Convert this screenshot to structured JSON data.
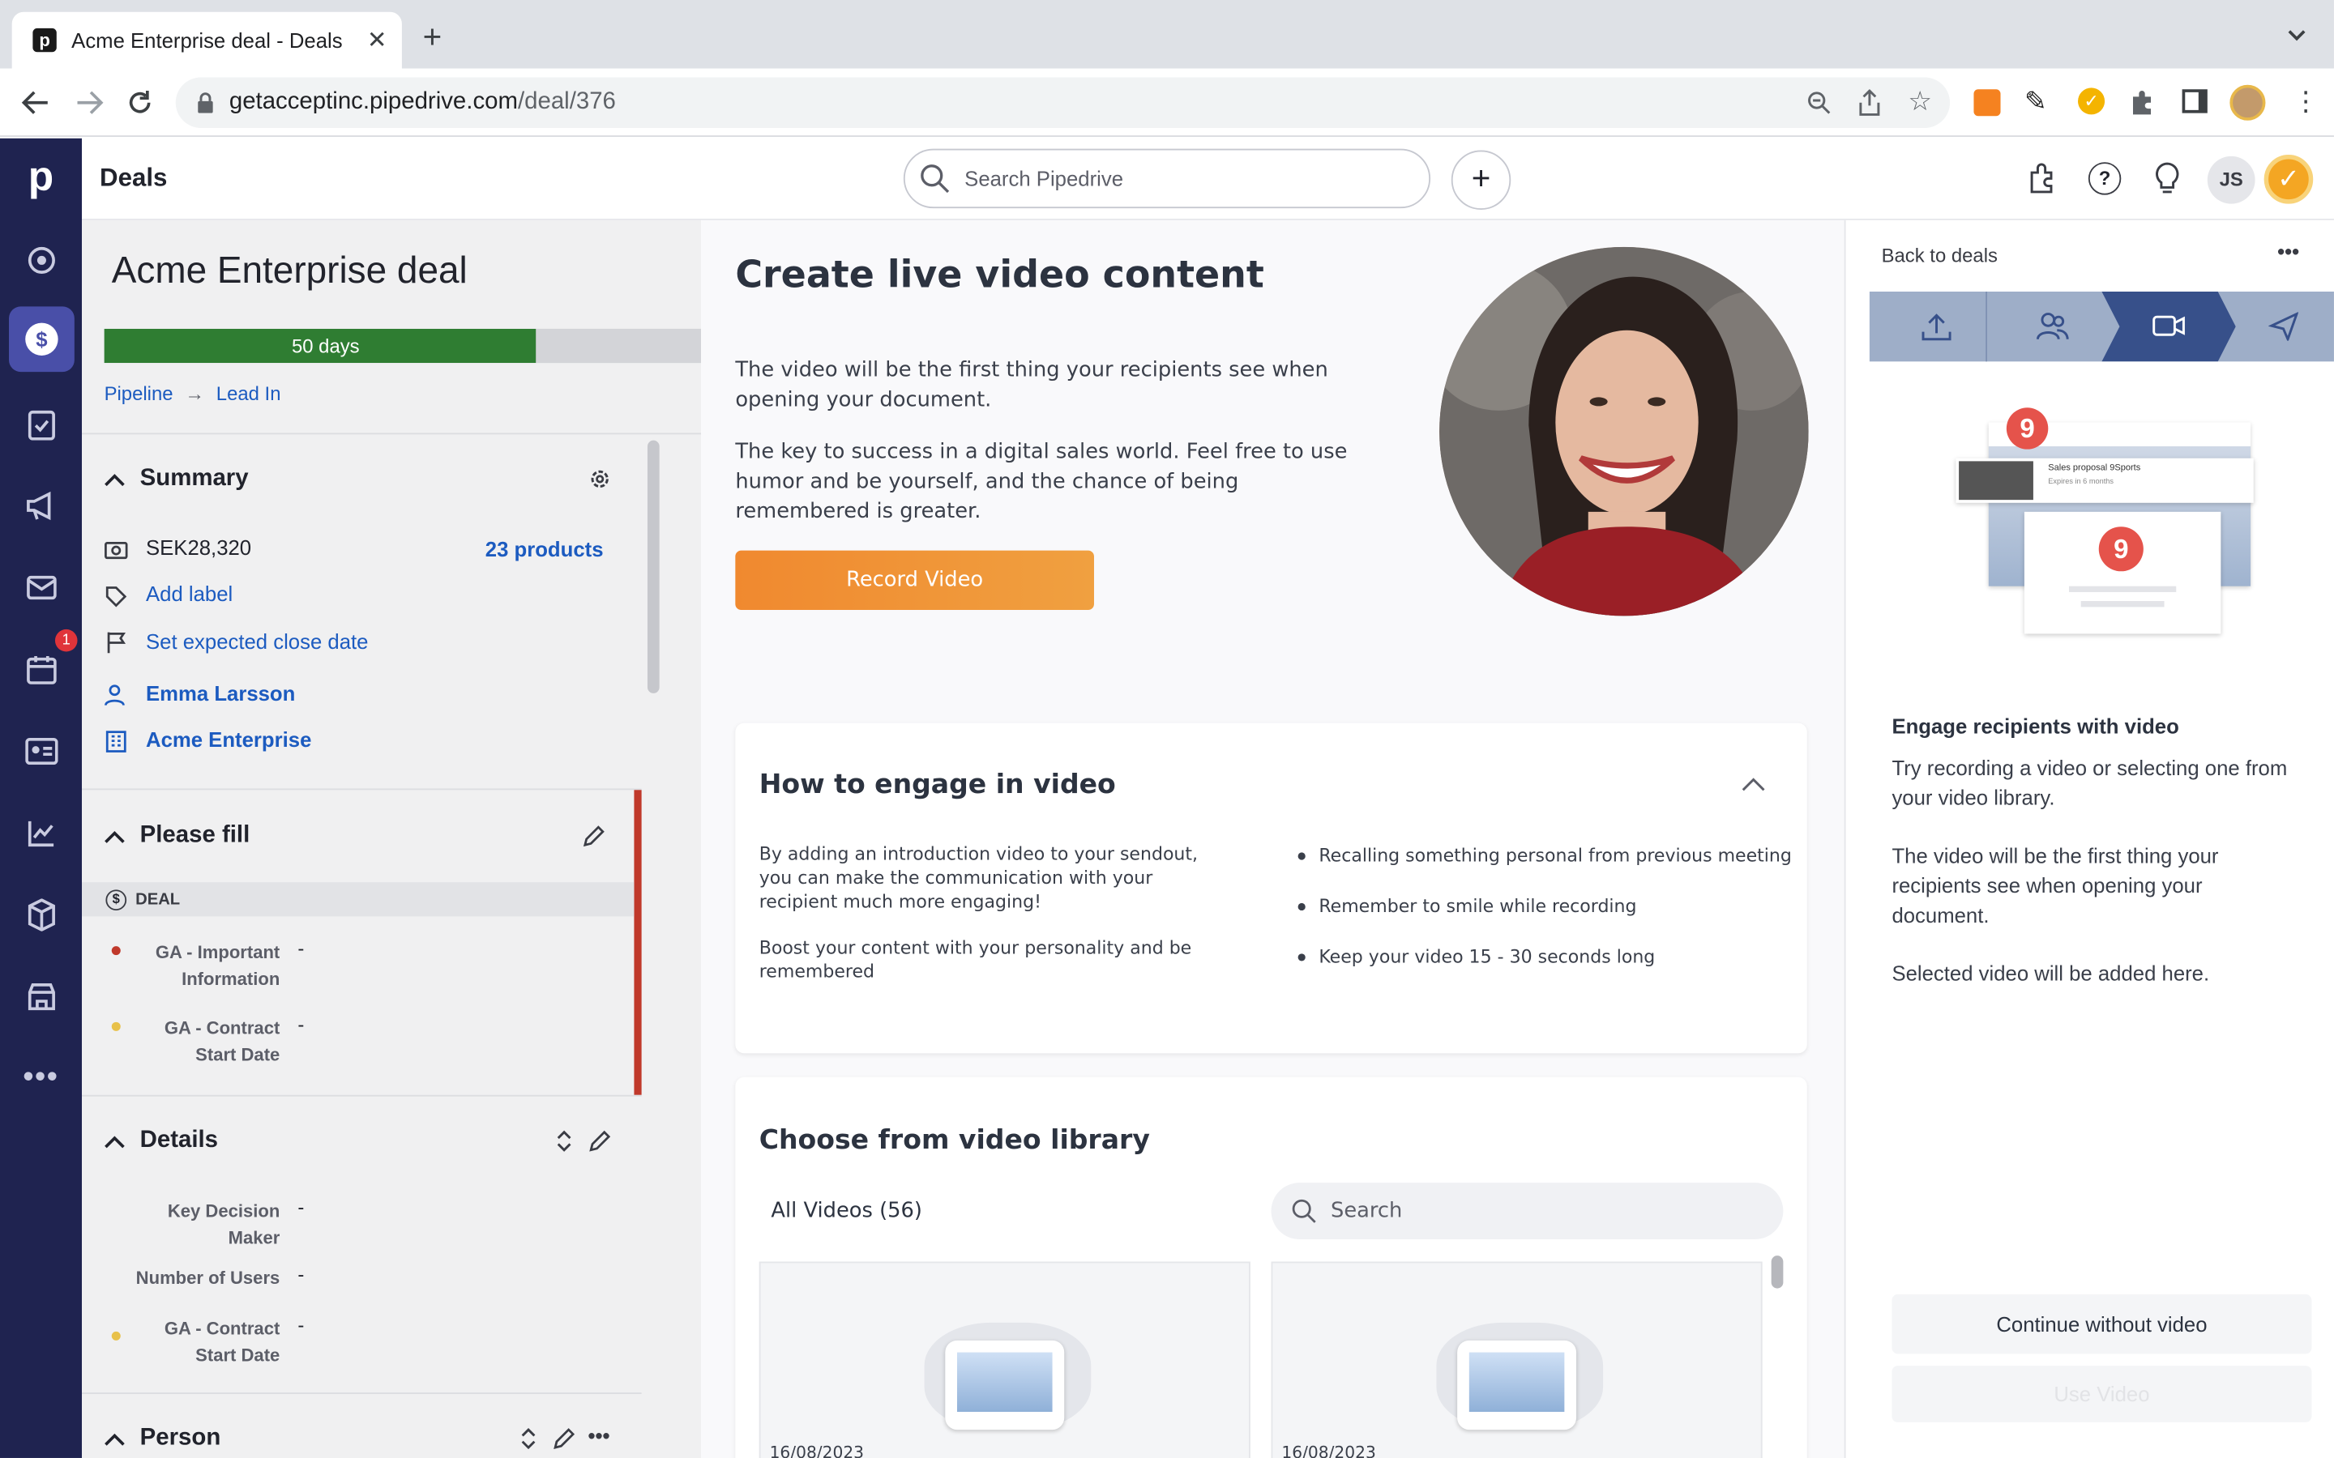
{
  "browser": {
    "tab_title": "Acme Enterprise deal - Deals",
    "url_domain": "getacceptinc.pipedrive.com",
    "url_path": "/deal/376"
  },
  "topbar": {
    "page_title": "Deals",
    "search_placeholder": "Search Pipedrive",
    "user_initials": "JS"
  },
  "nav": {
    "calendar_badge": "1"
  },
  "deal": {
    "title": "Acme Enterprise deal",
    "stage_days": "50 days",
    "breadcrumb_pipeline": "Pipeline",
    "breadcrumb_stage": "Lead In"
  },
  "summary": {
    "title": "Summary",
    "amount": "SEK28,320",
    "products": "23 products",
    "add_label": "Add label",
    "close_date": "Set expected close date",
    "person": "Emma Larsson",
    "org": "Acme Enterprise"
  },
  "please_fill": {
    "title": "Please fill",
    "deal_tag": "DEAL",
    "fields": [
      {
        "label": "GA - Important Information",
        "value": "-",
        "dot": "#c0392b"
      },
      {
        "label": "GA - Contract Start Date",
        "value": "-",
        "dot": "#e8c14a"
      }
    ]
  },
  "details": {
    "title": "Details",
    "fields": [
      {
        "label": "Key Decision Maker",
        "value": "-"
      },
      {
        "label": "Number of Users",
        "value": "-"
      },
      {
        "label": "GA - Contract Start Date",
        "value": "-"
      }
    ]
  },
  "person_section": {
    "title": "Person"
  },
  "video": {
    "heading": "Create live video content",
    "p1": "The video will be the first thing your recipients see when opening your document.",
    "p2": "The key to success in a digital sales world. Feel free to use humor and be yourself, and the chance of being remembered is greater.",
    "record_button": "Record Video"
  },
  "engage": {
    "heading": "How to engage in video",
    "left1": "By adding an introduction video to your sendout, you can make the communication with your recipient much more engaging!",
    "left2": "Boost your content with your personality and be remembered",
    "bullets": [
      "Recalling something personal from previous meeting",
      "Remember to smile while recording",
      "Keep your video 15 - 30 seconds long"
    ]
  },
  "library": {
    "heading": "Choose from video library",
    "filter": "All Videos (56)",
    "search_placeholder": "Search",
    "items": [
      {
        "date": "16/08/2023"
      },
      {
        "date": "16/08/2023"
      }
    ]
  },
  "panel": {
    "back": "Back to deals",
    "preview_title": "Sales proposal 9Sports",
    "preview_sub": "Expires in 6 months",
    "engage_title": "Engage recipients with video",
    "engage_p1": "Try recording a video or selecting one from your video library.",
    "engage_p2": "The video will be the first thing your recipients see when opening your document.",
    "engage_p3": "Selected video will be added here.",
    "continue_button": "Continue without video",
    "use_button": "Use Video"
  },
  "colors": {
    "nav_bg": "#1f2350",
    "accent": "#1c5bc0",
    "stage_green": "#2f7d32",
    "record_orange": "#f0892f",
    "panel_step": "#9eaec8",
    "panel_step_active": "#37508a"
  }
}
